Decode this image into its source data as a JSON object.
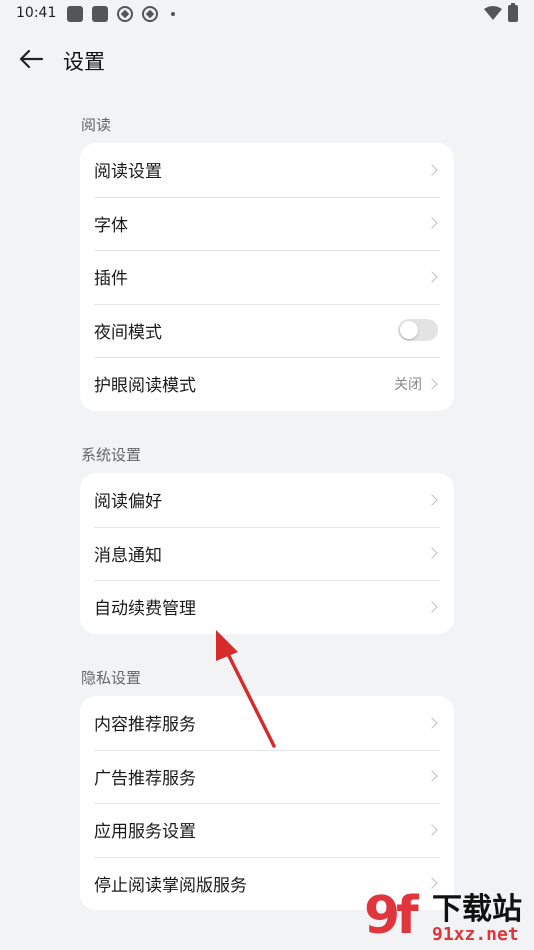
{
  "status_bar": {
    "time": "10:41"
  },
  "header": {
    "title": "设置"
  },
  "sections": [
    {
      "title": "阅读",
      "items": [
        {
          "label": "阅读设置",
          "type": "link"
        },
        {
          "label": "字体",
          "type": "link"
        },
        {
          "label": "插件",
          "type": "link"
        },
        {
          "label": "夜间模式",
          "type": "toggle",
          "on": false
        },
        {
          "label": "护眼阅读模式",
          "type": "link",
          "value": "关闭"
        }
      ]
    },
    {
      "title": "系统设置",
      "items": [
        {
          "label": "阅读偏好",
          "type": "link"
        },
        {
          "label": "消息通知",
          "type": "link"
        },
        {
          "label": "自动续费管理",
          "type": "link"
        }
      ]
    },
    {
      "title": "隐私设置",
      "items": [
        {
          "label": "内容推荐服务",
          "type": "link"
        },
        {
          "label": "广告推荐服务",
          "type": "link"
        },
        {
          "label": "应用服务设置",
          "type": "link"
        },
        {
          "label": "停止阅读掌阅版服务",
          "type": "link"
        }
      ]
    }
  ],
  "watermark": {
    "logo": "9f",
    "name": "下载站",
    "url": "91xz.net"
  },
  "colors": {
    "background": "#f1f3f5",
    "card": "#ffffff",
    "annotation_arrow": "#d62b2b",
    "watermark_red": "#e0353c"
  }
}
